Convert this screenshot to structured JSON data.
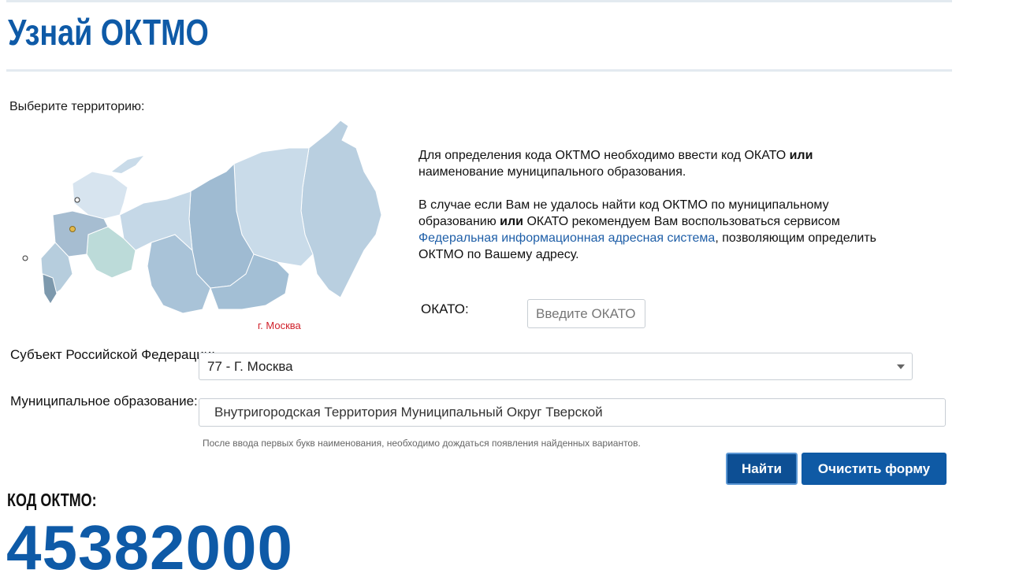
{
  "page": {
    "title": "Узнай ОКТМО",
    "select_territory": "Выберите территорию:",
    "map_caption": "г. Москва"
  },
  "info": {
    "p1_text": "Для определения кода ОКТМО необходимо ввести код ОКАТО ",
    "p1_bold": "или",
    "p1_text2": " наименование муниципального образования.",
    "p2_text": "В случае если Вам не удалось найти код ОКТМО по муниципальному образованию ",
    "p2_bold": "или",
    "p2_text2": " ОКАТО рекомендуем Вам воспользоваться сервисом ",
    "p2_link": "Федеральная информационная адресная система",
    "p2_text3": ", позволяющим определить ОКТМО по Вашему адресу."
  },
  "okato": {
    "label": "ОКАТО:",
    "placeholder": "Введите ОКАТО",
    "value": ""
  },
  "subject": {
    "label": "Субъект Российской Федерации:",
    "selected": "77 - Г. Москва"
  },
  "municipal": {
    "label": "Муниципальное образование:",
    "value": "Внутригородская Территория Муниципальный Округ Тверской",
    "hint": "После ввода первых букв наименования, необходимо дождаться появления найденных вариантов."
  },
  "buttons": {
    "find": "Найти",
    "clear": "Очистить форму"
  },
  "result": {
    "label": "КОД ОКТМО:",
    "value": "45382000"
  },
  "colors": {
    "brand": "#0e5aa7",
    "map_highlight": "#d0202a"
  }
}
